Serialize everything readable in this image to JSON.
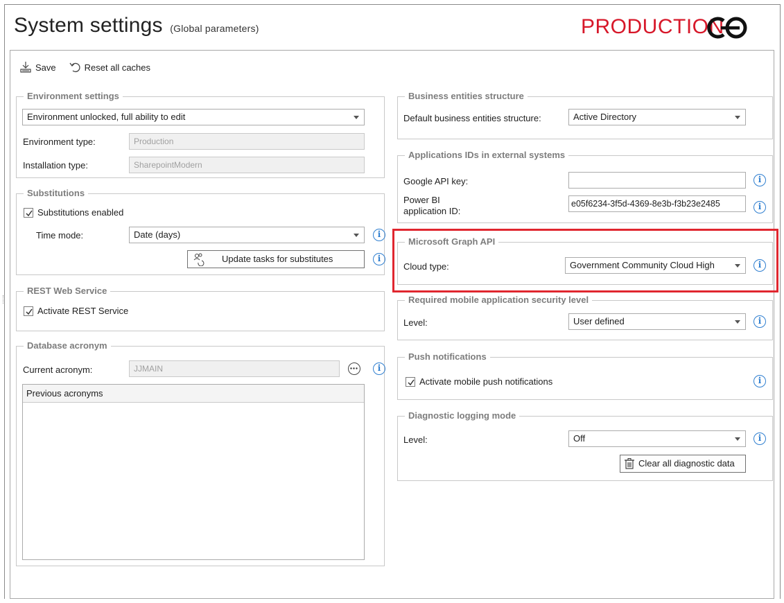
{
  "header": {
    "title": "System settings",
    "subtitle": "(Global parameters)",
    "environment_badge": "PRODUCTION",
    "badge_color": "#d7182a"
  },
  "toolbar": {
    "save_label": "Save",
    "save_icon": "save-icon",
    "reset_label": "Reset all caches",
    "reset_icon": "undo-icon"
  },
  "environment": {
    "title": "Environment settings",
    "mode_value": "Environment unlocked, full ability to edit",
    "type_label": "Environment type:",
    "type_value": "Production",
    "installation_label": "Installation type:",
    "installation_value": "SharepointModern"
  },
  "substitutions": {
    "title": "Substitutions",
    "enabled_label": "Substitutions enabled",
    "enabled_checked": true,
    "time_mode_label": "Time mode:",
    "time_mode_value": "Date (days)",
    "update_button_label": "Update tasks for substitutes"
  },
  "rest": {
    "title": "REST Web Service",
    "activate_label": "Activate REST Service",
    "activate_checked": true
  },
  "acronym": {
    "title": "Database acronym",
    "current_label": "Current acronym:",
    "current_value": "JJMAIN",
    "previous_header": "Previous acronyms"
  },
  "business": {
    "title": "Business entities structure",
    "default_label": "Default business entities structure:",
    "default_value": "Active Directory"
  },
  "app_ids": {
    "title": "Applications IDs in external systems",
    "google_label": "Google API key:",
    "google_value": "",
    "powerbi_label_line1": "Power BI",
    "powerbi_label_line2": "application ID:",
    "powerbi_value": "e05f6234-3f5d-4369-8e3b-f3b23e2485"
  },
  "graph": {
    "title": "Microsoft Graph API",
    "cloud_label": "Cloud type:",
    "cloud_value": "Government Community Cloud High",
    "highlight_color": "#e0262f"
  },
  "mobile_security": {
    "title": "Required mobile application security level",
    "level_label": "Level:",
    "level_value": "User defined"
  },
  "push": {
    "title": "Push notifications",
    "activate_label": "Activate mobile push notifications",
    "activate_checked": true
  },
  "diagnostic": {
    "title": "Diagnostic logging mode",
    "level_label": "Level:",
    "level_value": "Off",
    "clear_button_label": "Clear all diagnostic data"
  },
  "colors": {
    "info_icon": "#2f7fd0",
    "group_title": "#7d7d7d"
  }
}
